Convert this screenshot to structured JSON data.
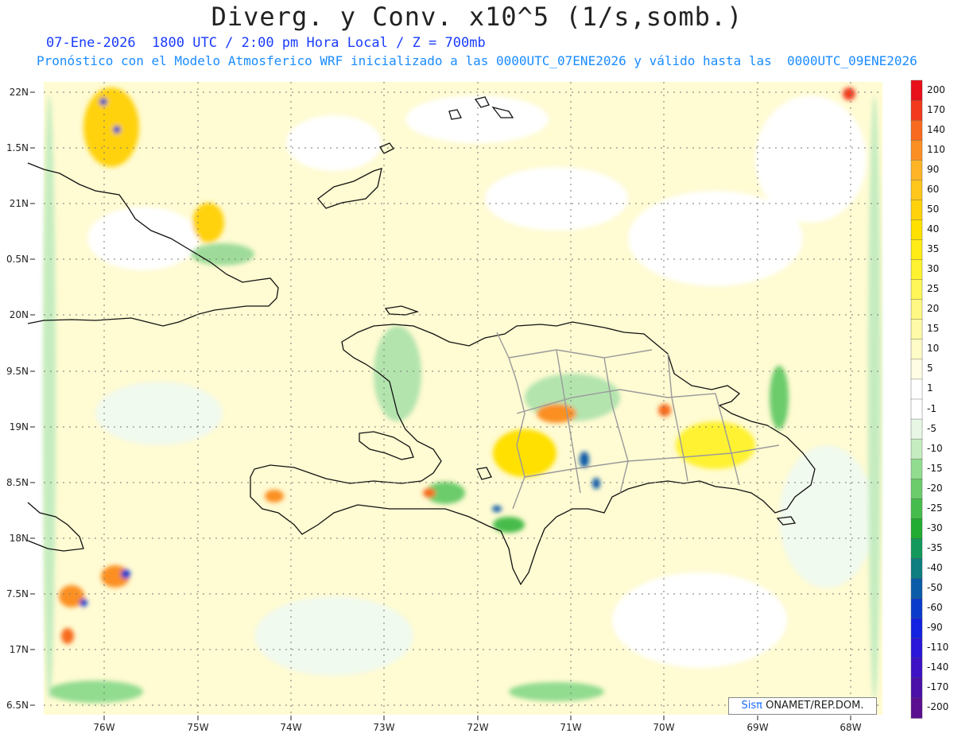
{
  "title": "Diverg. y Conv. x10^5 (1/s,somb.)",
  "subtitle_line1": "07-Ene-2026  1800 UTC / 2:00 pm Hora Local / Z = 700mb",
  "subtitle_line2": "Pronóstico con el Modelo Atmosferico WRF inicializado a las 0000UTC_07ENE2026 y válido hasta las  0000UTC_09ENE2026",
  "lat_labels": [
    "22N",
    "1.5N",
    "21N",
    "0.5N",
    "20N",
    "9.5N",
    "19N",
    "8.5N",
    "18N",
    "7.5N",
    "17N",
    "6.5N"
  ],
  "lon_labels": [
    "76W",
    "75W",
    "74W",
    "73W",
    "72W",
    "71W",
    "70W",
    "69W",
    "68W"
  ],
  "colorbar": {
    "labels": [
      "200",
      "170",
      "140",
      "110",
      "90",
      "60",
      "50",
      "40",
      "35",
      "30",
      "25",
      "20",
      "15",
      "10",
      "5",
      "1",
      "-1",
      "-5",
      "-10",
      "-15",
      "-20",
      "-25",
      "-30",
      "-35",
      "-40",
      "-50",
      "-60",
      "-90",
      "-110",
      "-140",
      "-170",
      "-200"
    ],
    "colors": [
      "#e8101a",
      "#f23a1e",
      "#f76a1f",
      "#fb8f24",
      "#ffb428",
      "#ffc61c",
      "#ffd20c",
      "#ffe000",
      "#ffeb16",
      "#fff230",
      "#fff65a",
      "#fff884",
      "#fffaa8",
      "#fffcc8",
      "#fffee4",
      "#ffffff",
      "#ffffff",
      "#e8f6e6",
      "#c4ecc0",
      "#92dc90",
      "#6ccc6c",
      "#46bc4c",
      "#22ac32",
      "#14985c",
      "#0e7e80",
      "#0a5ca8",
      "#0a3ccc",
      "#1222e0",
      "#2a16d8",
      "#3c12c4",
      "#4a10a8",
      "#5a0e90"
    ]
  },
  "credit": {
    "logo": "Sisπ",
    "text": " ONAMET/REP.DOM."
  }
}
